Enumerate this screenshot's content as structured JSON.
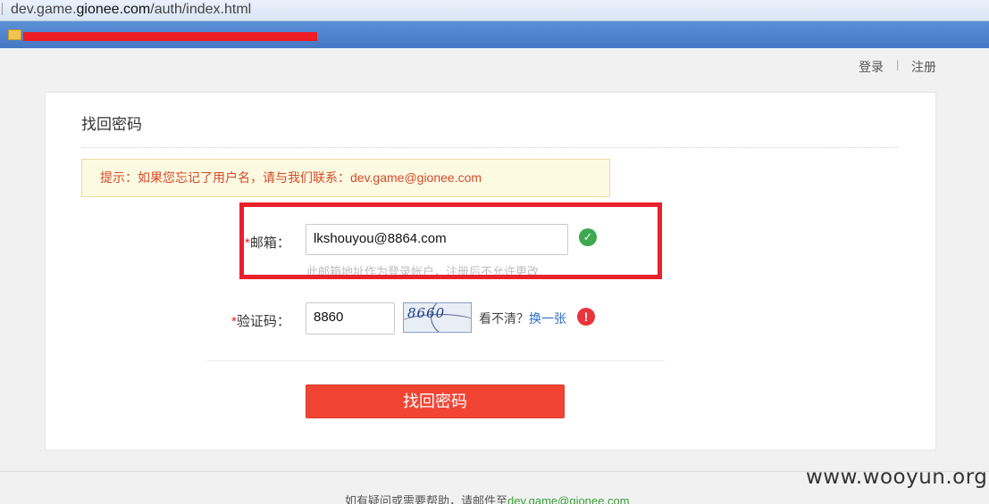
{
  "browser": {
    "url_prefix": "dev.game.",
    "url_domain": "gionee.com",
    "url_path": "/auth/index.html"
  },
  "topnav": {
    "login": "登录",
    "separator": "|",
    "register": "注册"
  },
  "form": {
    "title": "找回密码",
    "tip": "提示：如果您忘记了用户名，请与我们联系：dev.game@gionee.com",
    "email_required": "*",
    "email_label": "邮箱：",
    "email_value": "lkshouyou@8864.com",
    "email_hint": "此邮箱地址作为登录帐户，注册后不允许更改",
    "captcha_required": "*",
    "captcha_label": "验证码：",
    "captcha_value": "8860",
    "captcha_image_text": "8660",
    "unclear_text": "看不清？",
    "swap_text": "换一张",
    "submit_label": "找回密码"
  },
  "footer": {
    "text": "如有疑问或需要帮助，请邮件至",
    "email": "dev.game@gionee.com"
  },
  "watermark": "www.wooyun.org"
}
